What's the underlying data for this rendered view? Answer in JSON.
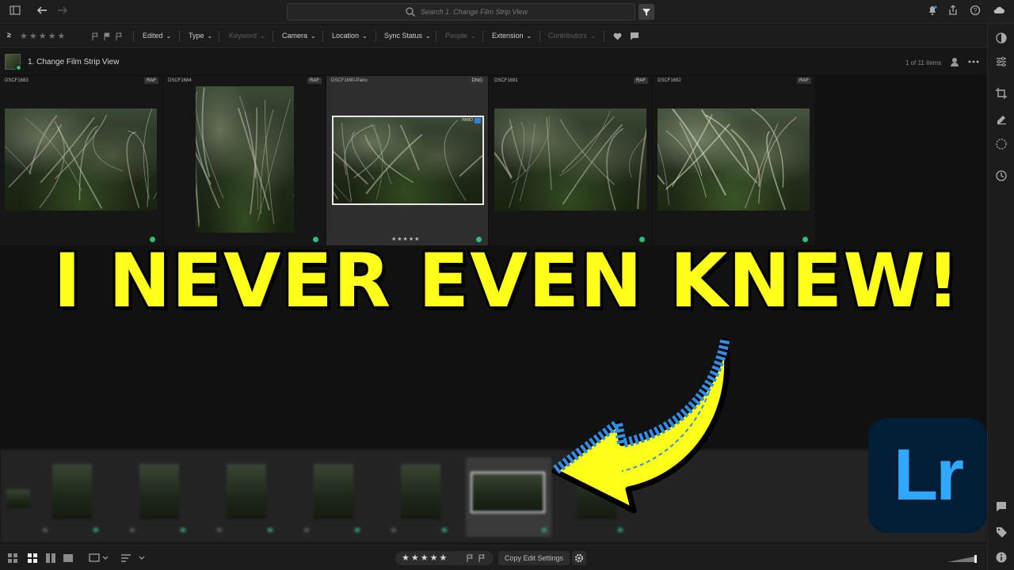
{
  "search": {
    "placeholder": "Search 1. Change Film Strip View"
  },
  "filters": {
    "rating_prefix": "≥",
    "stars": "★★★★★",
    "items": [
      {
        "label": "Edited",
        "enabled": true
      },
      {
        "label": "Type",
        "enabled": true
      },
      {
        "label": "Keyword",
        "enabled": false
      },
      {
        "label": "Camera",
        "enabled": true
      },
      {
        "label": "Location",
        "enabled": true
      },
      {
        "label": "Sync Status",
        "enabled": true
      },
      {
        "label": "People",
        "enabled": false
      },
      {
        "label": "Extension",
        "enabled": true
      },
      {
        "label": "Contributors",
        "enabled": false
      }
    ]
  },
  "album": {
    "title": "1. Change Film Strip View",
    "count": "1 of 11 items"
  },
  "photos": [
    {
      "name": "DSCF1683",
      "type": "RAF"
    },
    {
      "name": "DSCF1684",
      "type": "RAF"
    },
    {
      "name": "DSCF1690-Pano",
      "type": "DNG",
      "tag": "PANO",
      "stars": "★★★★★",
      "selected": true
    },
    {
      "name": "DSCF1691",
      "type": "RAF"
    },
    {
      "name": "DSCF1692",
      "type": "RAF"
    }
  ],
  "headline": "I NEVER EVEN KNEW!",
  "bottom": {
    "rating": "★★★★★",
    "copy_label": "Copy Edit Settings"
  },
  "logo": {
    "text": "Lr",
    "bg": "#001e36",
    "fg": "#31a8ff"
  },
  "colors": {
    "accent_yellow": "#ffff1a",
    "arrow_blue": "#2f8fe6",
    "sync_green": "#2ac07b"
  }
}
